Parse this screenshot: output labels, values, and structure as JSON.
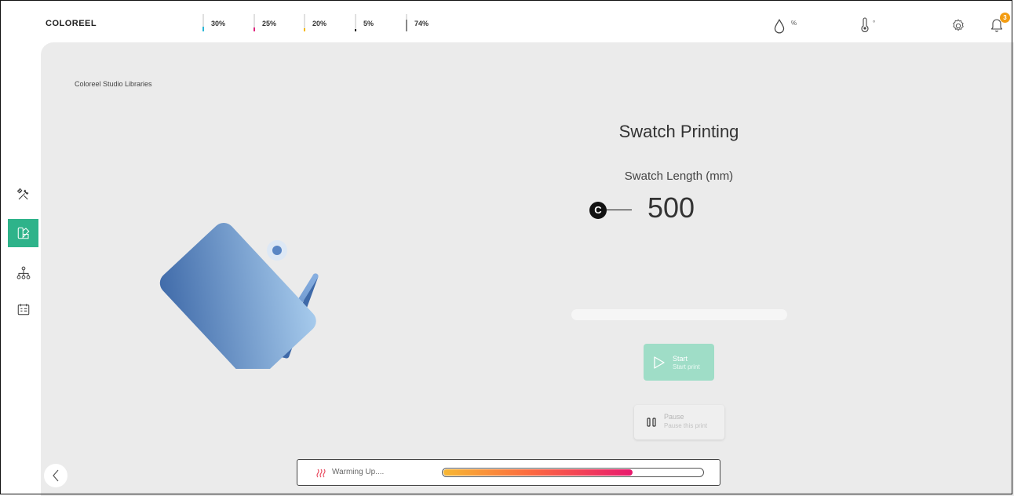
{
  "app": {
    "logo": "COLOREEL"
  },
  "inks": [
    {
      "name": "cyan",
      "value": "30%",
      "level": 0.3,
      "color": "#29b6d6"
    },
    {
      "name": "magenta",
      "value": "25%",
      "level": 0.25,
      "color": "#e0237d"
    },
    {
      "name": "yellow",
      "value": "20%",
      "level": 0.2,
      "color": "#f5b800"
    },
    {
      "name": "black",
      "value": "5%",
      "level": 0.05,
      "color": "#222222"
    },
    {
      "name": "gray",
      "value": "74%",
      "level": 0.74,
      "color": "#888888"
    }
  ],
  "status": {
    "humidity_unit": "%",
    "temperature_unit": "°",
    "notification_count": "3"
  },
  "sidebar": {
    "items": [
      {
        "icon": "tools-icon",
        "active": false
      },
      {
        "icon": "swatch-icon",
        "active": true
      },
      {
        "icon": "hierarchy-icon",
        "active": false
      },
      {
        "icon": "calendar-list-icon",
        "active": false
      }
    ]
  },
  "main": {
    "library_label": "Coloreel Studio Libraries",
    "title": "Swatch Printing",
    "length_label": "Swatch Length (mm)",
    "length_value": "500",
    "marker_label": "C",
    "start": {
      "label": "Start",
      "sublabel": "Start print"
    },
    "pause": {
      "label": "Pause",
      "sublabel": "Pause this print"
    }
  },
  "warming": {
    "label": "Warming Up....",
    "progress": 0.73
  },
  "colors": {
    "accent": "#2eb38a",
    "panel": "#ebebeb",
    "illustration_dark": "#3e69a8",
    "illustration_light": "#a9cdee"
  }
}
